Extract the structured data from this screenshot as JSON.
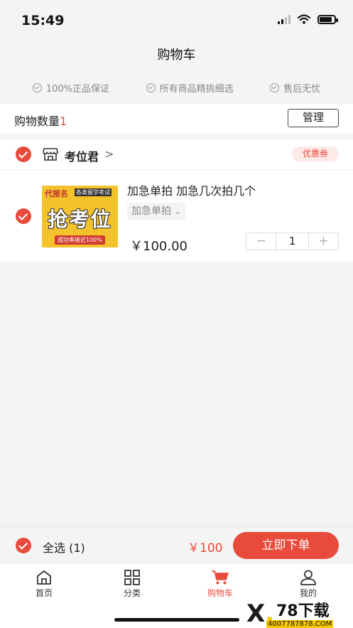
{
  "status_bar": {
    "time": "15:49"
  },
  "nav": {
    "title": "购物车"
  },
  "guarantees": [
    "100%正品保证",
    "所有商品精挑细选",
    "售后无忧"
  ],
  "cart_count": {
    "label": "购物数量",
    "value": "1",
    "manage_label": "管理"
  },
  "shop": {
    "name": "考位君",
    "chevron": ">",
    "coupon_label": "优惠券",
    "selected": true
  },
  "item": {
    "selected": true,
    "thumbnail": {
      "tag": "代报名",
      "tag2": "各类留学考试",
      "headline": "抢考位",
      "footer": "成功率接近100%"
    },
    "title": "加急单拍 加急几次拍几个",
    "spec": "加急单拍",
    "spec_arrow": "⌄",
    "price": "￥100.00",
    "quantity": "1",
    "minus": "−",
    "plus": "+"
  },
  "bottom_bar": {
    "select_all": "全选 (1)",
    "total": "￥100",
    "order_button": "立即下单",
    "selected": true
  },
  "tabs": [
    {
      "label": "首页",
      "icon": "home-icon",
      "active": false
    },
    {
      "label": "分类",
      "icon": "grid-icon",
      "active": false
    },
    {
      "label": "购物车",
      "icon": "cart-icon",
      "active": true
    },
    {
      "label": "我的",
      "icon": "user-icon",
      "active": false
    }
  ],
  "watermark": {
    "logo_text": "78下载",
    "url": "4007787878.COM"
  },
  "colors": {
    "accent": "#e84a3c",
    "background": "#f4f4f4",
    "coupon_bg": "#fde9e7"
  }
}
